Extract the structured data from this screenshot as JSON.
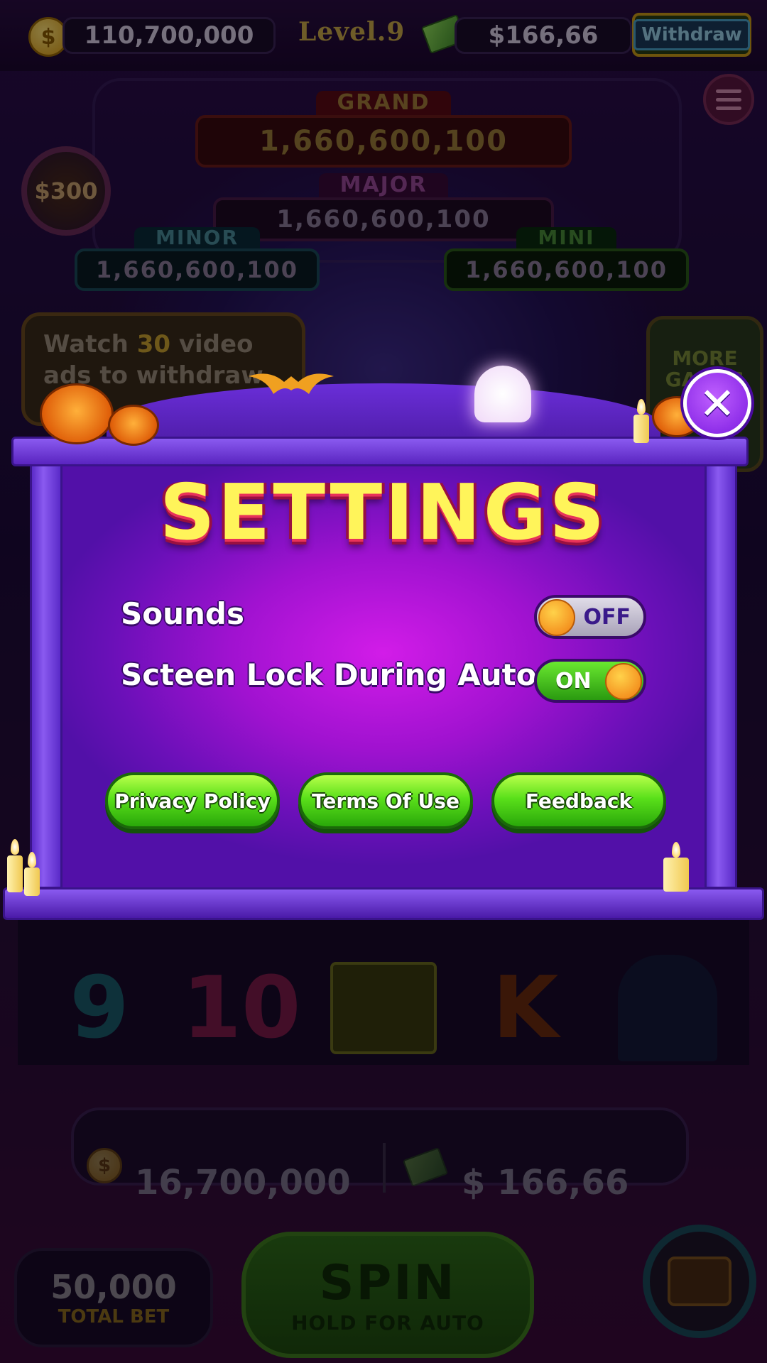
{
  "top_bar": {
    "coins": "110,700,000",
    "level": "Level.9",
    "cash": "$166,66",
    "withdraw_label": "Withdraw"
  },
  "jackpots": {
    "grand": {
      "label": "GRAND",
      "value": "1,660,600,100"
    },
    "major": {
      "label": "MAJOR",
      "value": "1,660,600,100"
    },
    "minor": {
      "label": "MINOR",
      "value": "1,660,600,100"
    },
    "mini": {
      "label": "MINI",
      "value": "1,660,600,100"
    }
  },
  "bonus_badge": "$300",
  "watch_ads": {
    "prefix": "Watch ",
    "count": "30",
    "suffix": " video ads to withdraw"
  },
  "more_games": "MORE GAMES",
  "reel_symbols": [
    "9",
    "10",
    "K"
  ],
  "bottom": {
    "balance": "16,700,000",
    "cash": "$ 166,66",
    "total_bet_value": "50,000",
    "total_bet_label": "TOTAL BET",
    "spin_label": "SPIN",
    "spin_sub": "HOLD FOR AUTO"
  },
  "settings": {
    "title": "SETTINGS",
    "options": [
      {
        "label": "Sounds",
        "state": "OFF"
      },
      {
        "label": "Scteen Lock During Auto",
        "state": "ON"
      }
    ],
    "buttons": [
      "Privacy Policy",
      "Terms Of Use",
      "Feedback"
    ],
    "close_icon": "close-x-icon"
  },
  "colors": {
    "panel_magenta": "#c018e0",
    "title_yellow": "#fff45a",
    "button_green": "#5ae01a",
    "toggle_knob": "#f07a10"
  }
}
